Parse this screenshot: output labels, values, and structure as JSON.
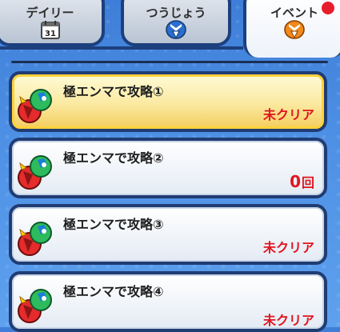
{
  "tabs": [
    {
      "label": "デイリー",
      "icon": "calendar-icon",
      "badge_text": "31",
      "active": false
    },
    {
      "label": "つうじょう",
      "icon": "blue-ribbon-icon",
      "active": false
    },
    {
      "label": "イベント",
      "icon": "orange-ribbon-icon",
      "active": true,
      "has_notification": true
    }
  ],
  "missions": [
    {
      "title": "極エンマで攻略①",
      "status": "未クリア",
      "selected": true,
      "icon": "enma-character-icon"
    },
    {
      "title": "極エンマで攻略②",
      "count_value": "0",
      "count_unit": "回",
      "selected": false,
      "icon": "enma-character-icon"
    },
    {
      "title": "極エンマで攻略③",
      "status": "未クリア",
      "selected": false,
      "icon": "enma-character-icon"
    },
    {
      "title": "極エンマで攻略④",
      "status": "未クリア",
      "selected": false,
      "icon": "enma-character-icon"
    }
  ],
  "colors": {
    "background": "#4a8ae2",
    "border": "#1f3c73",
    "selected_fill": "#f8dc7a",
    "status_red": "#e0151f",
    "notification": "#e61d2b"
  }
}
